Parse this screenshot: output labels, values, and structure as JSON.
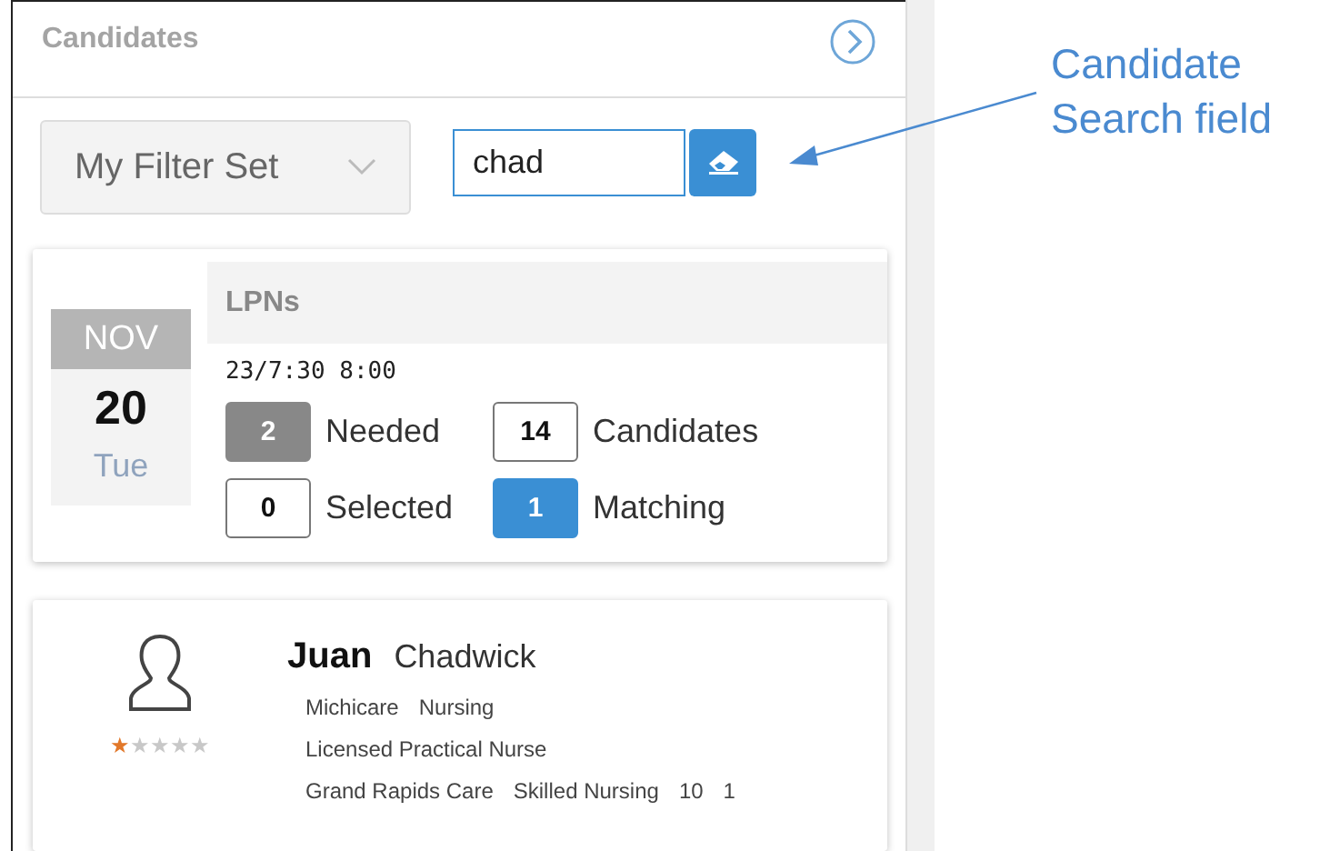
{
  "panel": {
    "title": "Candidates",
    "filter_set": {
      "value": "My Filter Set"
    },
    "search": {
      "value": "chad"
    },
    "shift": {
      "month": "NOV",
      "day": "20",
      "weekday": "Tue",
      "title": "LPNs",
      "time": "23/7:30 8:00",
      "stats": [
        {
          "count": "2",
          "label": "Needed",
          "kind": "filled",
          "color": "#888888"
        },
        {
          "count": "14",
          "label": "Candidates",
          "kind": "outlined"
        },
        {
          "count": "0",
          "label": "Selected",
          "kind": "outlined"
        },
        {
          "count": "1",
          "label": "Matching",
          "kind": "filled",
          "color": "#3a8fd4"
        }
      ]
    },
    "candidates": [
      {
        "first_name": "Juan",
        "last_name": "Chadwick",
        "stars": 1,
        "lines": [
          [
            "Michicare",
            "Nursing"
          ],
          [
            "Licensed Practical Nurse"
          ],
          [
            "Grand Rapids Care",
            "Skilled Nursing",
            "10",
            "1"
          ]
        ]
      }
    ]
  },
  "annotation": {
    "text": "Candidate Search field"
  }
}
